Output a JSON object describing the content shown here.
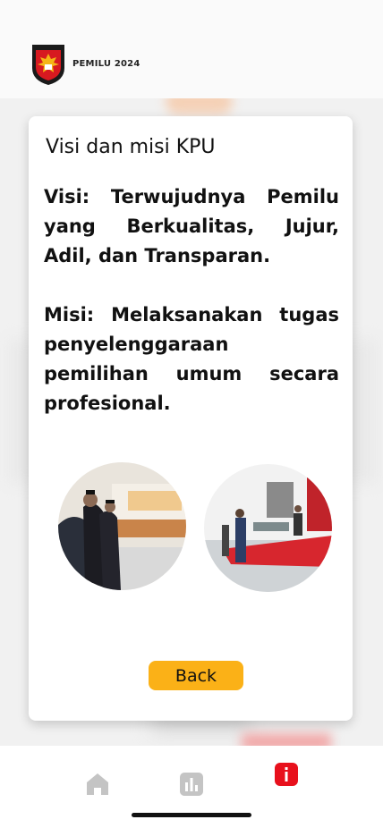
{
  "header": {
    "brand": "PEMILU 2024",
    "logo_icon": "kpu-garuda-logo"
  },
  "modal": {
    "title": "Visi dan misi KPU",
    "visi": "Visi: Terwujudnya Pemilu yang Berkualitas, Jujur, Adil, dan Transparan.",
    "misi": "Misi: Melaksanakan tugas penyelenggaraan pemilihan umum secara profesional.",
    "back_label": "Back"
  },
  "bottom_nav": {
    "items": [
      {
        "icon": "home-icon",
        "color": "#c4c4c4"
      },
      {
        "icon": "stats-icon",
        "color": "#c4c4c4"
      },
      {
        "icon": "info-icon",
        "color": "#e8101c"
      }
    ]
  },
  "colors": {
    "accent": "#fbb117",
    "active": "#e8101c"
  }
}
